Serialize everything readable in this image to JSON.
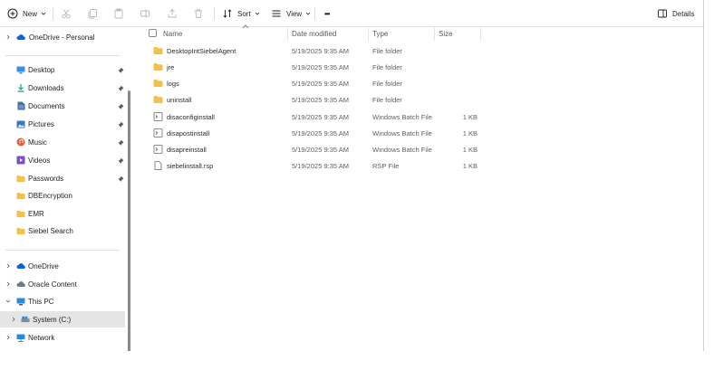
{
  "toolbar": {
    "new_label": "New",
    "sort_label": "Sort",
    "view_label": "View",
    "more_label": "•••",
    "details_label": "Details"
  },
  "sidebar": {
    "onedrive_personal": "OneDrive - Personal",
    "quick_access": [
      {
        "label": "Desktop",
        "icon": "desktop-icon",
        "color": "#3a8ee6"
      },
      {
        "label": "Downloads",
        "icon": "download-icon",
        "color": "#2a9d8f"
      },
      {
        "label": "Documents",
        "icon": "documents-icon",
        "color": "#4a6fa5"
      },
      {
        "label": "Pictures",
        "icon": "pictures-icon",
        "color": "#3b78c4"
      },
      {
        "label": "Music",
        "icon": "music-icon",
        "color": "#e0603a"
      },
      {
        "label": "Videos",
        "icon": "videos-icon",
        "color": "#7b4fc9"
      },
      {
        "label": "Passwords",
        "icon": "folder-icon",
        "color": "#f2c14e"
      },
      {
        "label": "DBEncryption",
        "icon": "folder-icon",
        "color": "#f2c14e"
      },
      {
        "label": "EMR",
        "icon": "folder-icon",
        "color": "#f2c14e"
      },
      {
        "label": "Siebel Search",
        "icon": "folder-icon",
        "color": "#f2c14e"
      }
    ],
    "tree": [
      {
        "label": "OneDrive",
        "icon": "cloud-icon"
      },
      {
        "label": "Oracle Content",
        "icon": "oracle-icon"
      },
      {
        "label": "This PC",
        "icon": "pc-icon"
      },
      {
        "label": "System (C:)",
        "icon": "drive-icon"
      },
      {
        "label": "Network",
        "icon": "network-icon"
      }
    ]
  },
  "columns": {
    "name": "Name",
    "date": "Date modified",
    "type": "Type",
    "size": "Size"
  },
  "files": [
    {
      "name": "DesktopIntSiebelAgent",
      "date": "5/19/2025 9:35 AM",
      "type": "File folder",
      "size": "",
      "icon": "folder-icon"
    },
    {
      "name": "jre",
      "date": "5/19/2025 9:35 AM",
      "type": "File folder",
      "size": "",
      "icon": "folder-icon"
    },
    {
      "name": "logs",
      "date": "5/19/2025 9:35 AM",
      "type": "File folder",
      "size": "",
      "icon": "folder-icon"
    },
    {
      "name": "uninstall",
      "date": "5/19/2025 9:35 AM",
      "type": "File folder",
      "size": "",
      "icon": "folder-icon"
    },
    {
      "name": "disaconfiginstall",
      "date": "5/19/2025 9:35 AM",
      "type": "Windows Batch File",
      "size": "1 KB",
      "icon": "batch-file-icon"
    },
    {
      "name": "disapostinstall",
      "date": "5/19/2025 9:35 AM",
      "type": "Windows Batch File",
      "size": "1 KB",
      "icon": "batch-file-icon"
    },
    {
      "name": "disapreinstall",
      "date": "5/19/2025 9:35 AM",
      "type": "Windows Batch File",
      "size": "1 KB",
      "icon": "batch-file-icon"
    },
    {
      "name": "siebelinstall.rsp",
      "date": "5/19/2025 9:35 AM",
      "type": "RSP File",
      "size": "1 KB",
      "icon": "file-icon"
    }
  ],
  "colors": {
    "folder": "#f2c14e",
    "accent": "#0067c0",
    "selected_bg": "#e5e5e5"
  }
}
